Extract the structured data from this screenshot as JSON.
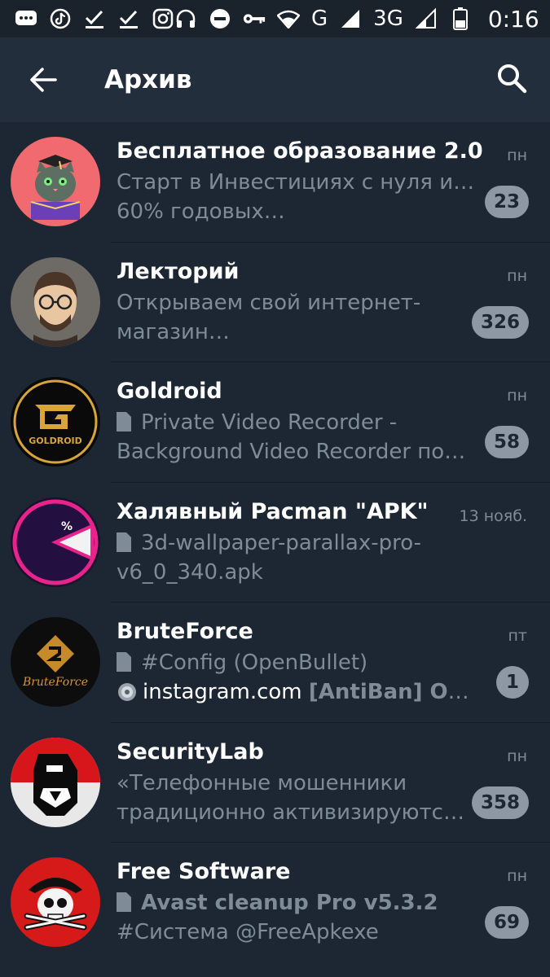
{
  "status_bar": {
    "network_g": "G",
    "network_3g": "3G",
    "time": "0:16",
    "icons": [
      "chat-icon",
      "tiktok-icon",
      "check-icon",
      "check-icon",
      "instagram-icon",
      "headphones-icon",
      "dnd-icon",
      "key-icon",
      "wifi-icon",
      "signal-icon",
      "signal-icon",
      "battery-icon"
    ]
  },
  "appbar": {
    "title": "Архив",
    "back_icon": "arrow-left-icon",
    "search_icon": "search-icon"
  },
  "colors": {
    "background": "#1d2733",
    "appbar": "#232e3c",
    "badge": "#8d98a4",
    "secondary_text": "#7f8b97"
  },
  "chats": [
    {
      "name": "Бесплатное образование 2.0",
      "preview_line1": "Старт в Инвестициях с нуля и до",
      "preview_line2": "60% годовых…",
      "date": "пн",
      "unread": "23"
    },
    {
      "name": "Лекторий",
      "preview_line1": "Открываем свой интернет-",
      "preview_line2": "магазин…",
      "date": "пн",
      "unread": "326"
    },
    {
      "name": "Goldroid",
      "preview_line1": "Private Video Recorder -",
      "preview_line2": "Background Video Recorder позв…",
      "date": "пн",
      "unread": "58",
      "avatar_text": "GOLDROID"
    },
    {
      "name": "Халявный Pacman \"APK\"",
      "preview_line1": "3d-wallpaper-parallax-pro-",
      "preview_line2": "v6_0_340.apk",
      "date": "13 нояб.",
      "avatar_text": "%"
    },
    {
      "name": "BruteForce",
      "preview_line1": "#Config (OpenBullet)",
      "preview_line2_a": "instagram.com ",
      "preview_line2_b": "[AntiBan] Open…",
      "date": "пт",
      "unread": "1",
      "avatar_text": "BruteForce"
    },
    {
      "name": "SecurityLab",
      "preview_line1": "«Телефонные мошенники",
      "preview_line2": "традиционно активизируются …",
      "date": "пн",
      "unread": "358"
    },
    {
      "name": "Free Software",
      "preview_line1": "Avast cleanup Pro v5.3.2",
      "preview_line2": "#Система @FreeApkexe",
      "date": "пн",
      "unread": "69"
    }
  ]
}
